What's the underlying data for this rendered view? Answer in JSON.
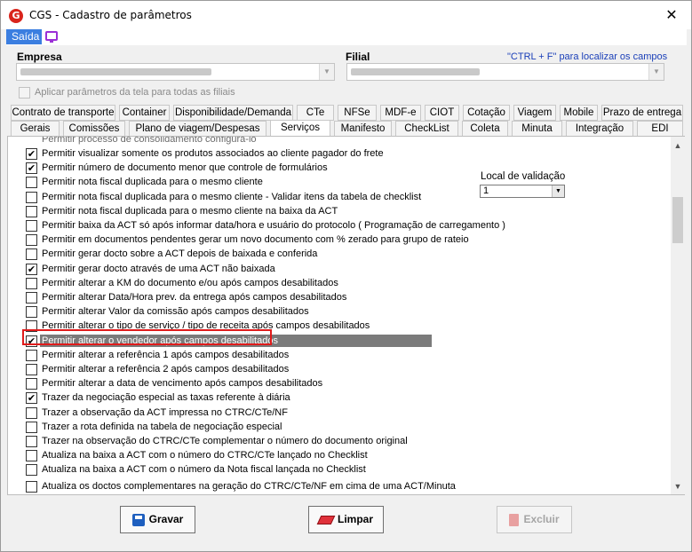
{
  "window": {
    "title": "CGS - Cadastro de parâmetros",
    "app_icon_letter": "G",
    "close_glyph": "✕"
  },
  "menu": {
    "saida": "Saída",
    "tv_icon": "monitor-icon"
  },
  "form": {
    "empresa_label": "Empresa",
    "filial_label": "Filial",
    "hint": "\"CTRL + F\" para localizar os campos",
    "apply_all_label": "Aplicar parâmetros da tela para todas as filiais"
  },
  "tabs_row1": [
    "Contrato de transporte",
    "Container",
    "Disponibilidade/Demanda",
    "CTe",
    "NFSe",
    "MDF-e",
    "CIOT",
    "Cotação",
    "Viagem",
    "Mobile",
    "Prazo de entrega"
  ],
  "tabs_row2": [
    "Gerais",
    "Comissões",
    "Plano de viagem/Despesas",
    "Serviços",
    "Manifesto",
    "CheckList",
    "Coleta",
    "Minuta",
    "Integração",
    "EDI"
  ],
  "active_tab": "Serviços",
  "params": [
    {
      "label": "Permitir visualizar somente os produtos associados ao cliente pagador do frete",
      "checked": true
    },
    {
      "label": "Permitir número de documento menor que controle de formulários",
      "checked": true
    },
    {
      "label": "Permitir nota fiscal duplicada para o mesmo cliente",
      "checked": false
    },
    {
      "label": "Permitir nota fiscal duplicada para o mesmo cliente - Validar itens da tabela de checklist",
      "checked": false
    },
    {
      "label": "Permitir nota fiscal duplicada para o mesmo cliente na baixa da ACT",
      "checked": false
    },
    {
      "label": "Permitir baixa da ACT só após informar data/hora e usuário do protocolo ( Programação de carregamento )",
      "checked": false
    },
    {
      "label": "Permitir em documentos pendentes gerar um novo documento com % zerado para grupo de rateio",
      "checked": false
    },
    {
      "label": "Permitir gerar docto sobre a ACT depois de baixada e conferida",
      "checked": false
    },
    {
      "label": "Permitir gerar docto através de uma ACT não baixada",
      "checked": true
    },
    {
      "label": "Permitir alterar a KM do documento e/ou após campos desabilitados",
      "checked": false
    },
    {
      "label": "Permitir alterar Data/Hora prev. da entrega após campos desabilitados",
      "checked": false
    },
    {
      "label": "Permitir alterar Valor da comissão após campos desabilitados",
      "checked": false
    },
    {
      "label": "Permitir alterar o tipo de serviço / tipo de receita após campos desabilitados",
      "checked": false
    },
    {
      "label": "Permitir alterar o vendedor após campos desabilitados",
      "checked": true,
      "selected": true
    },
    {
      "label": "Permitir alterar a referência 1 após campos desabilitados",
      "checked": false
    },
    {
      "label": "Permitir alterar a referência 2 após campos desabilitados",
      "checked": false
    },
    {
      "label": "Permitir alterar a data de vencimento após campos desabilitados",
      "checked": false
    },
    {
      "label": "Trazer da negociação especial as taxas referente à diária",
      "checked": true
    },
    {
      "label": "Trazer a observação da ACT impressa no CTRC/CTe/NF",
      "checked": false
    },
    {
      "label": "Trazer a rota definida na tabela de negociação especial",
      "checked": false
    },
    {
      "label": "Trazer na observação do CTRC/CTe complementar o número do documento original",
      "checked": false
    },
    {
      "label": "Atualiza na baixa a ACT com o número do CTRC/CTe lançado no Checklist",
      "checked": false
    },
    {
      "label": "Atualiza na baixa a ACT com o número da Nota fiscal lançada no Checklist",
      "checked": false
    },
    {
      "label": "Atualiza os doctos complementares na geração do CTRC/CTe/NF em cima de uma ACT/Minuta",
      "checked": false
    }
  ],
  "partial_top_label": "Permitir processo de consolidamento configura-lo",
  "local_validacao": {
    "label": "Local de validação",
    "value": "1"
  },
  "buttons": {
    "gravar": "Gravar",
    "limpar": "Limpar",
    "excluir": "Excluir"
  },
  "colors": {
    "accent": "#3b7ee0",
    "highlight_border": "#e01b1b",
    "selection": "#7b7b7b"
  }
}
